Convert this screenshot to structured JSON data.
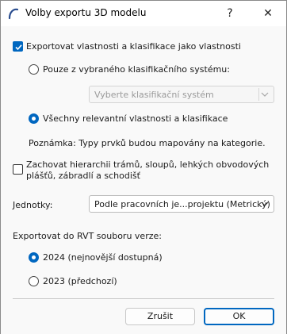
{
  "window": {
    "title": "Volby exportu 3D modelu",
    "help_glyph": "?",
    "close_glyph": "✕",
    "icon": "app-arc-icon"
  },
  "export_properties": {
    "label": "Exportovat vlastnosti a klasifikace jako vlastnosti",
    "checked": true
  },
  "classification_mode": {
    "option_selected_only": {
      "label": "Pouze z vybraného klasifikačního systému:",
      "selected": false
    },
    "system_select": {
      "placeholder": "Vyberte klasifikační systém",
      "disabled": true
    },
    "option_all": {
      "label": "Všechny relevantní vlastnosti a klasifikace",
      "selected": true
    }
  },
  "note": "Poznámka: Typy prvků budou mapovány na kategorie.",
  "hierarchy": {
    "line1": "Zachovat hierarchii trámů, sloupů, lehkých obvodových",
    "line2": "plášťů, zábradlí a schodišť",
    "checked": false
  },
  "units": {
    "label": "Jednotky:",
    "value": "Podle pracovních je...projektu (Metrický)"
  },
  "rvt_version": {
    "heading": "Exportovat do RVT souboru verze:",
    "options": [
      {
        "label": "2024 (nejnovější dostupná)",
        "selected": true
      },
      {
        "label": "2023 (předchozí)",
        "selected": false
      }
    ]
  },
  "buttons": {
    "cancel": "Zrušit",
    "ok": "OK"
  },
  "colors": {
    "accent": "#0067c0"
  }
}
